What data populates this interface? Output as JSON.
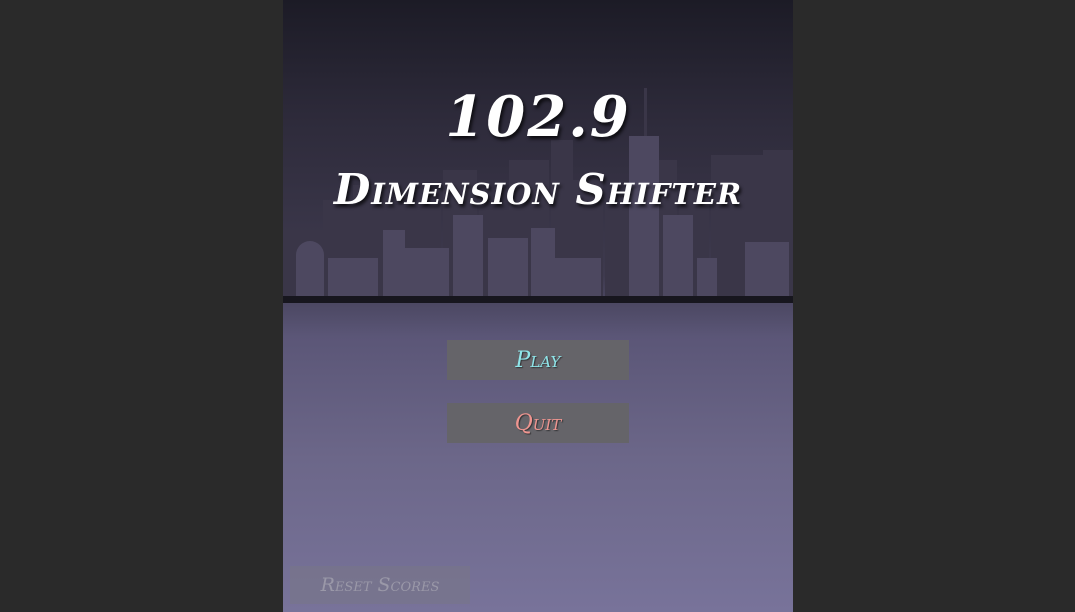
{
  "title": {
    "number": "102.9",
    "name": "Dimension Shifter"
  },
  "menu": {
    "play_label": "Play",
    "quit_label": "Quit",
    "reset_label": "Reset Scores"
  },
  "colors": {
    "background": "#2a2a2a",
    "play_text": "#8fe6ea",
    "quit_text": "#ef9590",
    "button_bg": "#656469",
    "title_text": "#ffffff"
  },
  "icons": {
    "skyline": "city-skyline-icon"
  }
}
